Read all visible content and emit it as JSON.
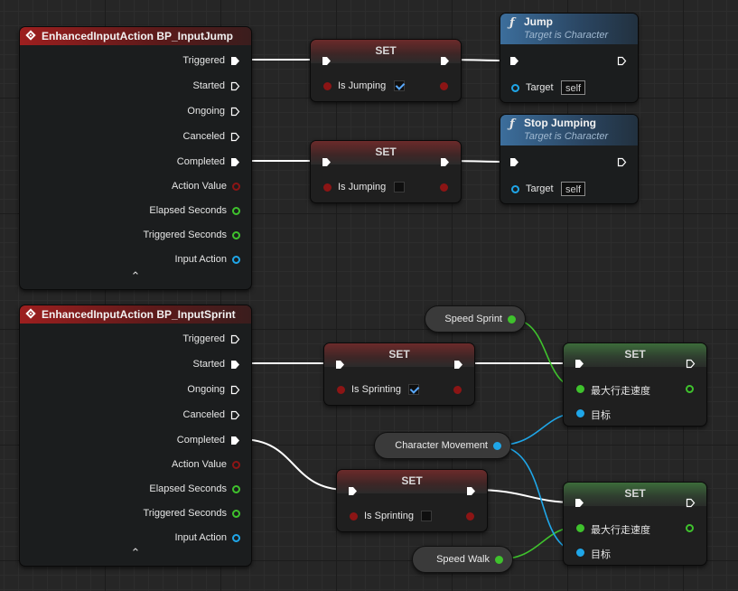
{
  "event_jump": {
    "title": "EnhancedInputAction BP_InputJump",
    "pins": [
      "Triggered",
      "Started",
      "Ongoing",
      "Canceled",
      "Completed",
      "Action Value",
      "Elapsed Seconds",
      "Triggered Seconds",
      "Input Action"
    ]
  },
  "event_sprint": {
    "title": "EnhancedInputAction BP_InputSprint",
    "pins": [
      "Triggered",
      "Started",
      "Ongoing",
      "Canceled",
      "Completed",
      "Action Value",
      "Elapsed Seconds",
      "Triggered Seconds",
      "Input Action"
    ]
  },
  "set_jump_true": {
    "title": "SET",
    "var_label": "Is Jumping",
    "checked": true
  },
  "set_jump_false": {
    "title": "SET",
    "var_label": "Is Jumping",
    "checked": false
  },
  "func_jump": {
    "title": "Jump",
    "subtitle": "Target is Character",
    "target_label": "Target",
    "target_value": "self"
  },
  "func_stop": {
    "title": "Stop Jumping",
    "subtitle": "Target is Character",
    "target_label": "Target",
    "target_value": "self"
  },
  "set_sprint_true": {
    "title": "SET",
    "var_label": "Is Sprinting",
    "checked": true
  },
  "set_sprint_false": {
    "title": "SET",
    "var_label": "Is Sprinting",
    "checked": false
  },
  "set_speed_sprint": {
    "title": "SET",
    "speed_label": "最大行走速度",
    "target_label": "目标"
  },
  "set_speed_walk": {
    "title": "SET",
    "speed_label": "最大行走速度",
    "target_label": "目标"
  },
  "var_speed_sprint": {
    "label": "Speed Sprint"
  },
  "var_char_move": {
    "label": "Character Movement"
  },
  "var_speed_walk": {
    "label": "Speed Walk"
  },
  "colors": {
    "exec": "#ffffff",
    "bool": "#8c1515",
    "float": "#3fc22d",
    "object": "#1fa6e8",
    "struct": "#d0d0d0"
  }
}
